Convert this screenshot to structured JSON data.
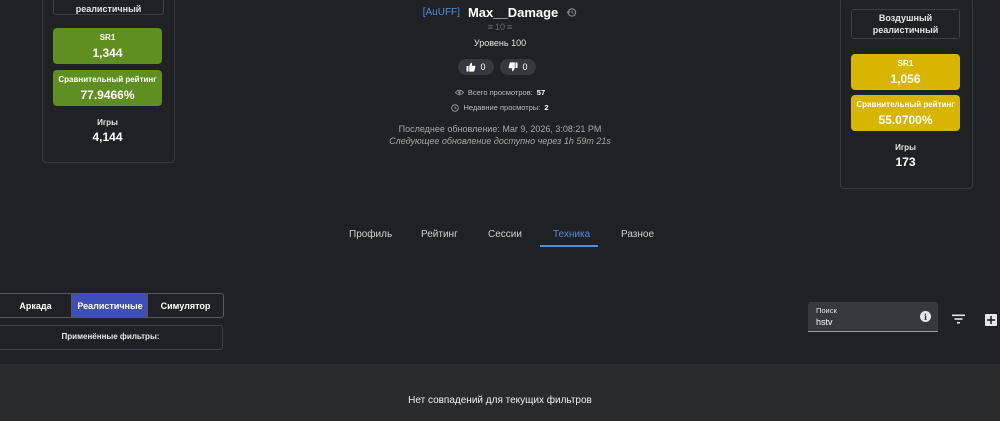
{
  "left_card": {
    "title": "Танковый реалистичный",
    "sr_label": "SR1",
    "sr_value": "1,344",
    "rating_label": "Сравнительный рейтинг",
    "rating_value": "77.9466%",
    "games_label": "Игры",
    "games_value": "4,144",
    "tile_color": "#5e8f20"
  },
  "right_card": {
    "title": "Воздушный реалистичный",
    "sr_label": "SR1",
    "sr_value": "1,056",
    "rating_label": "Сравнительный рейтинг",
    "rating_value": "55.0700%",
    "games_label": "Игры",
    "games_value": "173",
    "tile_color": "#d8b500"
  },
  "player": {
    "clan": "[AuUFF]",
    "name": "Max__Damage",
    "rank": "10",
    "level": "Уровень 100",
    "likes": "0",
    "dislikes": "0",
    "total_views_label": "Всего просмотров:",
    "total_views": "57",
    "recent_views_label": "Недавние просмотры:",
    "recent_views": "2",
    "last_update": "Последнее обновление: Mar 9, 2026, 3:08:21 PM",
    "next_update": "Следующее обновление доступно через 1h 59m 21s"
  },
  "tabs": [
    "Профиль",
    "Рейтинг",
    "Сессии",
    "Техника",
    "Разное"
  ],
  "active_tab": "Техника",
  "modes": [
    "Аркада",
    "Реалистичные",
    "Симулятор"
  ],
  "active_mode": "Реалистичные",
  "filters_label": "Применённые фильтры:",
  "search": {
    "label": "Поиск",
    "value": "hstv"
  },
  "empty_message": "Нет совпадений для текущих фильтров",
  "colors": {
    "accent": "#4a90d9",
    "active_mode_bg": "#3f4fb8"
  }
}
